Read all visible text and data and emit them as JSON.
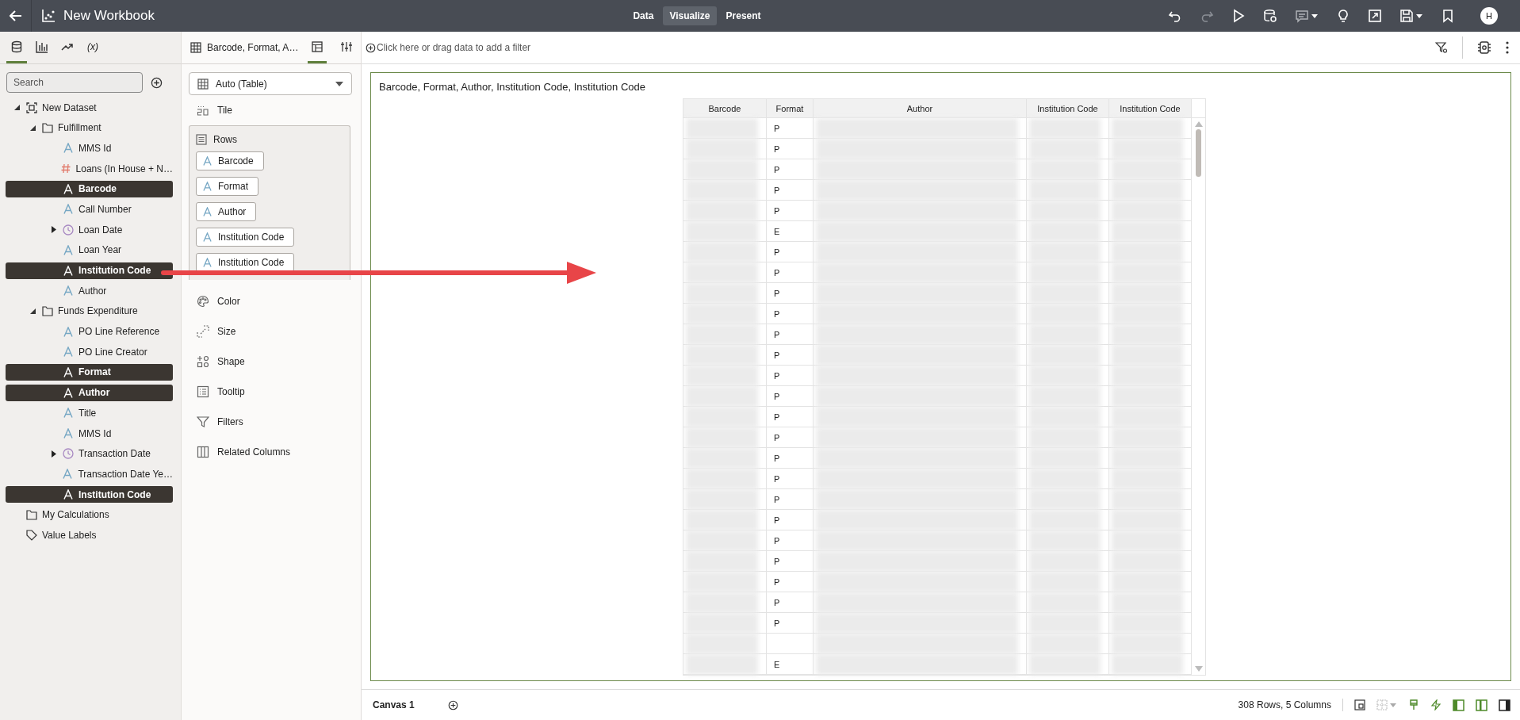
{
  "header": {
    "title": "New Workbook",
    "modes": [
      {
        "label": "Data",
        "selected": false
      },
      {
        "label": "Visualize",
        "selected": true
      },
      {
        "label": "Present",
        "selected": false
      }
    ],
    "avatar": "H"
  },
  "data_panel": {
    "tabs": [
      {
        "kind": "data",
        "selected": true
      },
      {
        "kind": "viz",
        "selected": false
      },
      {
        "kind": "analytics",
        "selected": false
      },
      {
        "kind": "calc",
        "label": "(x)",
        "selected": false
      }
    ],
    "search": {
      "placeholder": "Search"
    },
    "tree": [
      {
        "kind": "dataset",
        "label": "New Dataset",
        "expanded": true,
        "children": [
          {
            "kind": "folder",
            "label": "Fulfillment",
            "expanded": true,
            "children": [
              {
                "kind": "text",
                "label": "MMS Id",
                "selected": false
              },
              {
                "kind": "number",
                "label": "Loans (In House + N…",
                "selected": false
              },
              {
                "kind": "text",
                "label": "Barcode",
                "selected": true
              },
              {
                "kind": "text",
                "label": "Call Number",
                "selected": false
              },
              {
                "kind": "date",
                "label": "Loan Date",
                "selected": false,
                "expanded": false
              },
              {
                "kind": "text",
                "label": "Loan Year",
                "selected": false
              },
              {
                "kind": "text",
                "label": "Institution Code",
                "selected": true
              },
              {
                "kind": "text",
                "label": "Author",
                "selected": false
              }
            ]
          },
          {
            "kind": "folder",
            "label": "Funds Expenditure",
            "expanded": true,
            "children": [
              {
                "kind": "text",
                "label": "PO Line Reference",
                "selected": false
              },
              {
                "kind": "text",
                "label": "PO Line Creator",
                "selected": false
              },
              {
                "kind": "text",
                "label": "Format",
                "selected": true
              },
              {
                "kind": "text",
                "label": "Author",
                "selected": true
              },
              {
                "kind": "text",
                "label": "Title",
                "selected": false
              },
              {
                "kind": "text",
                "label": "MMS Id",
                "selected": false
              },
              {
                "kind": "date",
                "label": "Transaction Date",
                "selected": false,
                "expanded": false
              },
              {
                "kind": "text",
                "label": "Transaction Date Ye…",
                "selected": false
              },
              {
                "kind": "text",
                "label": "Institution Code",
                "selected": true
              }
            ]
          }
        ]
      },
      {
        "kind": "folder",
        "label": "My Calculations"
      },
      {
        "kind": "labels",
        "label": "Value Labels"
      }
    ]
  },
  "grammar_panel": {
    "viz_name": "Barcode, Format, A…",
    "tabs": [
      {
        "kind": "grammar",
        "selected": true
      },
      {
        "kind": "properties",
        "selected": false
      }
    ],
    "viz_type": "Auto (Table)",
    "tile": "Tile",
    "rows_label": "Rows",
    "rows": [
      "Barcode",
      "Format",
      "Author",
      "Institution Code",
      "Institution Code"
    ],
    "sections": [
      {
        "kind": "color",
        "label": "Color"
      },
      {
        "kind": "size",
        "label": "Size"
      },
      {
        "kind": "shape",
        "label": "Shape"
      },
      {
        "kind": "tooltip",
        "label": "Tooltip"
      },
      {
        "kind": "filters",
        "label": "Filters"
      },
      {
        "kind": "related",
        "label": "Related Columns"
      }
    ]
  },
  "filter_bar": {
    "placeholder": "Click here or drag data to add a filter"
  },
  "viz": {
    "title": "Barcode, Format, Author, Institution Code, Institution Code",
    "table": {
      "columns": [
        {
          "label": "Barcode",
          "blurred": true
        },
        {
          "label": "Format",
          "blurred": false
        },
        {
          "label": "Author",
          "blurred": true
        },
        {
          "label": "Institution Code",
          "blurred": true
        },
        {
          "label": "Institution Code",
          "blurred": true
        }
      ],
      "rows": [
        [
          "P"
        ],
        [
          "P"
        ],
        [
          "P"
        ],
        [
          "P"
        ],
        [
          "P"
        ],
        [
          "E"
        ],
        [
          "P"
        ],
        [
          "P"
        ],
        [
          "P"
        ],
        [
          "P"
        ],
        [
          "P"
        ],
        [
          "P"
        ],
        [
          "P"
        ],
        [
          "P"
        ],
        [
          "P"
        ],
        [
          "P"
        ],
        [
          "P"
        ],
        [
          "P"
        ],
        [
          "P"
        ],
        [
          "P"
        ],
        [
          "P"
        ],
        [
          "P"
        ],
        [
          "P"
        ],
        [
          "P"
        ],
        [
          "P"
        ],
        [
          null
        ],
        [
          "E"
        ]
      ]
    }
  },
  "footer": {
    "canvas_tab": "Canvas 1",
    "summary": "308 Rows, 5 Columns"
  }
}
